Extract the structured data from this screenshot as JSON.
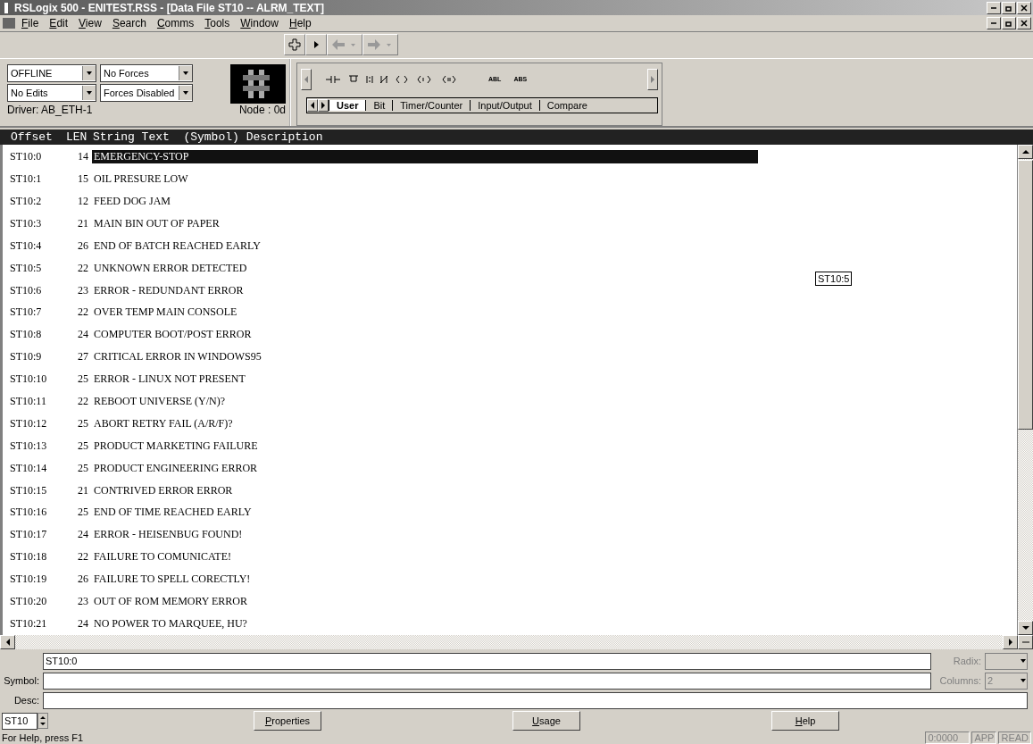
{
  "window": {
    "title": "RSLogix 500 - ENITEST.RSS - [Data File ST10  --  ALRM_TEXT]"
  },
  "menu": [
    "File",
    "Edit",
    "View",
    "Search",
    "Comms",
    "Tools",
    "Window",
    "Help"
  ],
  "status_panel": {
    "mode": "OFFLINE",
    "forces": "No Forces",
    "edits": "No Edits",
    "forces_state": "Forces Disabled",
    "driver": "Driver: AB_ETH-1",
    "node": "Node : 0d"
  },
  "palette": {
    "labels": [
      "ABL",
      "ABS"
    ],
    "tabs": [
      {
        "label": "User",
        "selected": true
      },
      {
        "label": "Bit",
        "selected": false
      },
      {
        "label": "Timer/Counter",
        "selected": false
      },
      {
        "label": "Input/Output",
        "selected": false
      },
      {
        "label": "Compare",
        "selected": false
      }
    ]
  },
  "table": {
    "columns": [
      "Offset",
      "LEN",
      "String Text  (Symbol) Description"
    ],
    "rows": [
      {
        "offset": "ST10:0",
        "len": "14",
        "text": "EMERGENCY-STOP",
        "selected": true
      },
      {
        "offset": "ST10:1",
        "len": "15",
        "text": "OIL PRESURE LOW",
        "selected": false
      },
      {
        "offset": "ST10:2",
        "len": "12",
        "text": "FEED DOG JAM",
        "selected": false
      },
      {
        "offset": "ST10:3",
        "len": "21",
        "text": "MAIN BIN OUT OF PAPER",
        "selected": false
      },
      {
        "offset": "ST10:4",
        "len": "26",
        "text": "END OF BATCH REACHED EARLY",
        "selected": false
      },
      {
        "offset": "ST10:5",
        "len": "22",
        "text": "UNKNOWN ERROR DETECTED",
        "selected": false
      },
      {
        "offset": "ST10:6",
        "len": "23",
        "text": "ERROR - REDUNDANT ERROR",
        "selected": false
      },
      {
        "offset": "ST10:7",
        "len": "22",
        "text": "OVER TEMP MAIN CONSOLE",
        "selected": false
      },
      {
        "offset": "ST10:8",
        "len": "24",
        "text": "COMPUTER BOOT/POST ERROR",
        "selected": false
      },
      {
        "offset": "ST10:9",
        "len": "27",
        "text": "CRITICAL ERROR IN WINDOWS95",
        "selected": false
      },
      {
        "offset": "ST10:10",
        "len": "25",
        "text": "ERROR - LINUX NOT PRESENT",
        "selected": false
      },
      {
        "offset": "ST10:11",
        "len": "22",
        "text": "REBOOT UNIVERSE (Y/N)?",
        "selected": false
      },
      {
        "offset": "ST10:12",
        "len": "25",
        "text": "ABORT RETRY FAIL (A/R/F)?",
        "selected": false
      },
      {
        "offset": "ST10:13",
        "len": "25",
        "text": "PRODUCT MARKETING FAILURE",
        "selected": false
      },
      {
        "offset": "ST10:14",
        "len": "25",
        "text": "PRODUCT ENGINEERING ERROR",
        "selected": false
      },
      {
        "offset": "ST10:15",
        "len": "21",
        "text": "CONTRIVED ERROR ERROR",
        "selected": false
      },
      {
        "offset": "ST10:16",
        "len": "25",
        "text": "END OF TIME REACHED EARLY",
        "selected": false
      },
      {
        "offset": "ST10:17",
        "len": "24",
        "text": "ERROR - HEISENBUG FOUND!",
        "selected": false
      },
      {
        "offset": "ST10:18",
        "len": "22",
        "text": "FAILURE TO COMUNICATE!",
        "selected": false
      },
      {
        "offset": "ST10:19",
        "len": "26",
        "text": "FAILURE TO SPELL CORECTLY!",
        "selected": false
      },
      {
        "offset": "ST10:20",
        "len": "23",
        "text": "OUT OF ROM MEMORY ERROR",
        "selected": false
      },
      {
        "offset": "ST10:21",
        "len": "24",
        "text": "NO POWER TO MARQUEE, HU?",
        "selected": false
      }
    ],
    "tooltip": "ST10:5"
  },
  "editor": {
    "address": "ST10:0",
    "radix_label": "Radix:",
    "symbol_label": "Symbol:",
    "columns_label": "Columns:",
    "columns": "2",
    "desc_label": "Desc:",
    "file": "ST10"
  },
  "buttons": [
    "Properties",
    "Usage",
    "Help"
  ],
  "status_bar": {
    "hint": "For Help, press F1",
    "position": "0:0000",
    "app": "APP",
    "mode": "READ"
  }
}
